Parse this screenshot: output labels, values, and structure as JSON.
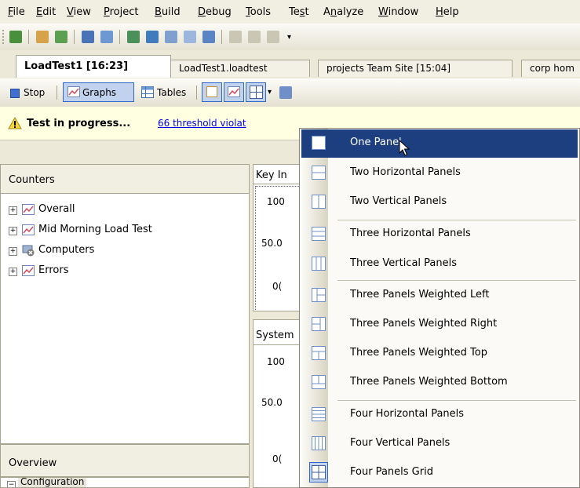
{
  "menu_bar": {
    "items": [
      "File",
      "Edit",
      "View",
      "Project",
      "Build",
      "Debug",
      "Tools",
      "Test",
      "Analyze",
      "Window",
      "Help"
    ],
    "underline": [
      "F",
      "E",
      "V",
      "P",
      "B",
      "D",
      "T",
      "s",
      "n",
      "W",
      "H"
    ]
  },
  "tabs": [
    {
      "label": "LoadTest1 [16:23]",
      "active": true
    },
    {
      "label": "LoadTest1.loadtest",
      "active": false
    },
    {
      "label": "projects Team Site [15:04]",
      "active": false
    },
    {
      "label": "corp hom",
      "active": false
    }
  ],
  "toolbar2": {
    "stop_label": "Stop",
    "graphs_label": "Graphs",
    "tables_label": "Tables"
  },
  "infobar": {
    "status": "Test in progress...",
    "link": "66 threshold violat"
  },
  "counters_panel": {
    "title": "Counters",
    "items": [
      "Overall",
      "Mid Morning Load Test",
      "Computers",
      "Errors"
    ]
  },
  "overview_panel": {
    "title": "Overview",
    "item": "Configuration"
  },
  "graph1": {
    "title": "Key In",
    "ticks": [
      "100",
      "50.0",
      "0("
    ]
  },
  "graph2": {
    "title": "System",
    "ticks": [
      "100",
      "50.0",
      "0("
    ]
  },
  "layout_menu": {
    "items": [
      {
        "label": "One Panel",
        "icon": "one-panel-icon",
        "selected": true
      },
      {
        "label": "Two Horizontal Panels",
        "icon": "two-horizontal-panels-icon"
      },
      {
        "label": "Two Vertical Panels",
        "icon": "two-vertical-panels-icon"
      },
      {
        "label": "Three Horizontal Panels",
        "icon": "three-horizontal-panels-icon"
      },
      {
        "label": "Three Vertical Panels",
        "icon": "three-vertical-panels-icon"
      },
      {
        "label": "Three Panels Weighted Left",
        "icon": "three-panels-weighted-left-icon"
      },
      {
        "label": "Three Panels Weighted Right",
        "icon": "three-panels-weighted-right-icon"
      },
      {
        "label": "Three Panels Weighted Top",
        "icon": "three-panels-weighted-top-icon"
      },
      {
        "label": "Three Panels Weighted Bottom",
        "icon": "three-panels-weighted-bottom-icon"
      },
      {
        "label": "Four Horizontal Panels",
        "icon": "four-horizontal-panels-icon"
      },
      {
        "label": "Four Vertical Panels",
        "icon": "four-vertical-panels-icon"
      },
      {
        "label": "Four Panels Grid",
        "icon": "four-panels-grid-icon"
      }
    ],
    "selected_color": "#1d3f7f"
  },
  "colors": {
    "chrome": "#ece9d8",
    "highlight": "#1d3f7f",
    "link": "#0000ee",
    "icon_blue": "#6f8fc8"
  }
}
